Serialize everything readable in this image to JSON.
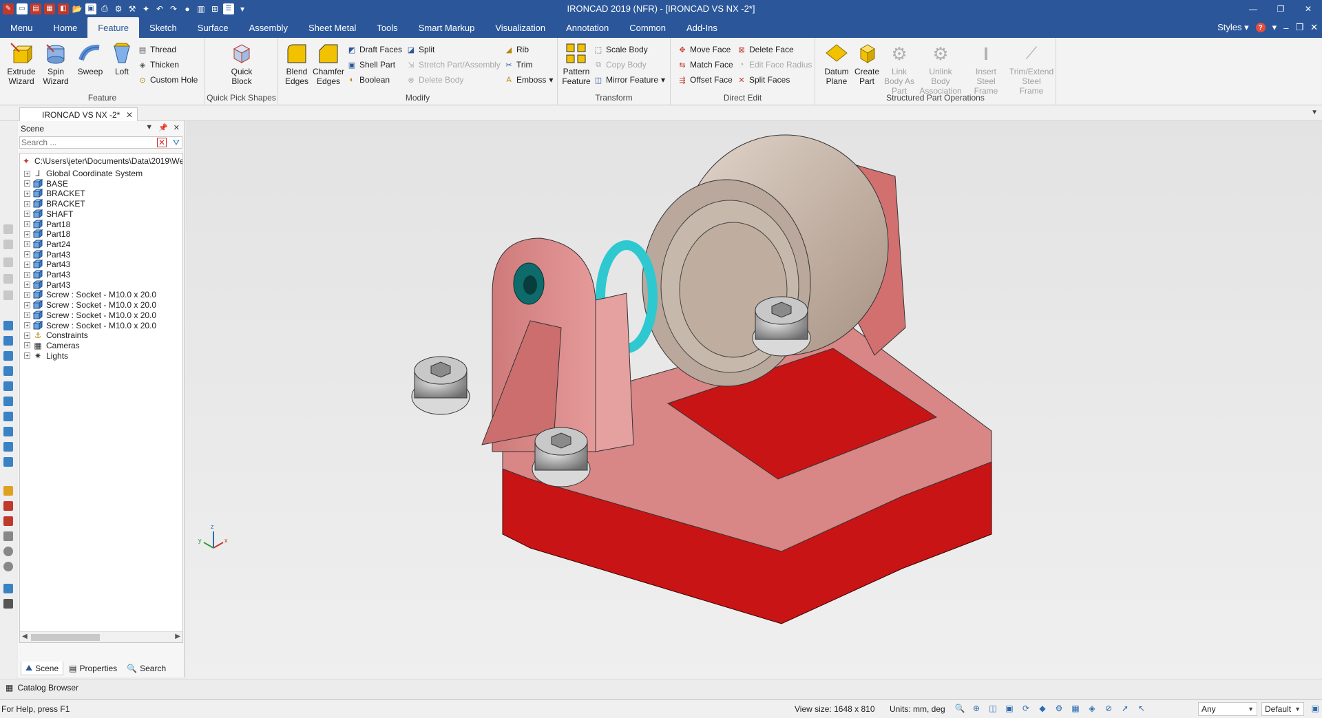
{
  "window": {
    "title": "IRONCAD 2019 (NFR) - [IRONCAD VS NX -2*]"
  },
  "menu_tabs": [
    {
      "label": "Menu"
    },
    {
      "label": "Home"
    },
    {
      "label": "Feature",
      "active": true
    },
    {
      "label": "Sketch"
    },
    {
      "label": "Surface"
    },
    {
      "label": "Assembly"
    },
    {
      "label": "Sheet Metal"
    },
    {
      "label": "Tools"
    },
    {
      "label": "Smart Markup"
    },
    {
      "label": "Visualization"
    },
    {
      "label": "Annotation"
    },
    {
      "label": "Common"
    },
    {
      "label": "Add-Ins"
    }
  ],
  "styles_label": "Styles",
  "ribbon": {
    "feature": {
      "label": "Feature",
      "extrude": "Extrude Wizard",
      "spin": "Spin Wizard",
      "sweep": "Sweep",
      "loft": "Loft",
      "thread": "Thread",
      "thicken": "Thicken",
      "custom_hole": "Custom Hole"
    },
    "quick": {
      "label": "Quick Pick Shapes",
      "quick_block": "Quick Block"
    },
    "modify": {
      "label": "Modify",
      "blend": "Blend Edges",
      "chamfer": "Chamfer Edges",
      "draft_faces": "Draft Faces",
      "shell_part": "Shell Part",
      "boolean": "Boolean",
      "split": "Split",
      "stretch": "Stretch Part/Assembly",
      "delete_body": "Delete Body",
      "rib": "Rib",
      "trim": "Trim",
      "emboss": "Emboss"
    },
    "transform": {
      "label": "Transform",
      "pattern": "Pattern Feature",
      "scale_body": "Scale Body",
      "copy_body": "Copy Body",
      "mirror": "Mirror Feature"
    },
    "direct_edit": {
      "label": "Direct Edit",
      "move_face": "Move Face",
      "match_face": "Match Face",
      "offset_face": "Offset Face",
      "delete_face": "Delete Face",
      "edit_face_radius": "Edit Face Radius",
      "split_faces": "Split Faces"
    },
    "structured": {
      "label": "Structured Part Operations",
      "datum_plane": "Datum Plane",
      "create_part": "Create Part",
      "link_body": "Link Body As Part",
      "unlink_body": "Unlink Body Association",
      "insert_steel": "Insert Steel Frame",
      "trim_extend": "Trim/Extend Steel Frame"
    }
  },
  "document_tab": {
    "label": "IRONCAD VS NX -2*"
  },
  "scene": {
    "title": "Scene",
    "search_placeholder": "Search ...",
    "root": "C:\\Users\\jeter\\Documents\\Data\\2019\\We",
    "items": [
      {
        "label": "Global Coordinate System",
        "kind": "axis"
      },
      {
        "label": "BASE",
        "kind": "part"
      },
      {
        "label": "BRACKET",
        "kind": "part"
      },
      {
        "label": "BRACKET",
        "kind": "part"
      },
      {
        "label": "SHAFT",
        "kind": "part"
      },
      {
        "label": "Part18",
        "kind": "part"
      },
      {
        "label": "Part18",
        "kind": "part"
      },
      {
        "label": "Part24",
        "kind": "part"
      },
      {
        "label": "Part43",
        "kind": "part"
      },
      {
        "label": "Part43",
        "kind": "part"
      },
      {
        "label": "Part43",
        "kind": "part"
      },
      {
        "label": "Part43",
        "kind": "part"
      },
      {
        "label": "Screw : Socket - M10.0 x 20.0",
        "kind": "part"
      },
      {
        "label": "Screw : Socket - M10.0 x 20.0",
        "kind": "part"
      },
      {
        "label": "Screw : Socket - M10.0 x 20.0",
        "kind": "part"
      },
      {
        "label": "Screw : Socket - M10.0 x 20.0",
        "kind": "part"
      },
      {
        "label": "Constraints",
        "kind": "constraints"
      },
      {
        "label": "Cameras",
        "kind": "cameras"
      },
      {
        "label": "Lights",
        "kind": "lights"
      }
    ],
    "tabs": [
      {
        "label": "Scene",
        "active": true
      },
      {
        "label": "Properties"
      },
      {
        "label": "Search"
      }
    ]
  },
  "triad": {
    "x": "x",
    "y": "y",
    "z": "z"
  },
  "catalog_browser": "Catalog Browser",
  "status": {
    "help": "For Help, press F1",
    "view_size": "View size: 1648 x 810",
    "units": "Units: mm, deg",
    "filter": "Any",
    "style": "Default"
  },
  "colors": {
    "accent": "#2b579a",
    "part_red": "#c81414",
    "wheel": "#c8b8aa",
    "ring": "#2ec8d0"
  }
}
